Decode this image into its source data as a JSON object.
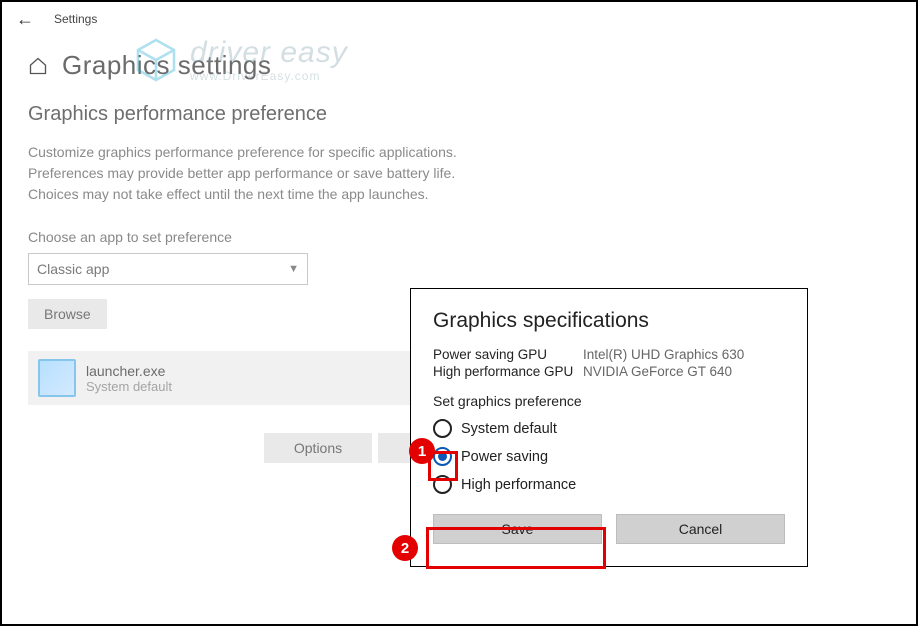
{
  "topbar": {
    "label": "Settings"
  },
  "page": {
    "title": "Graphics settings",
    "subheading": "Graphics performance preference",
    "desc_line1": "Customize graphics performance preference for specific applications.",
    "desc_line2": "Preferences may provide better app performance or save battery life.",
    "desc_line3": "Choices may not take effect until the next time the app launches."
  },
  "chooser": {
    "label": "Choose an app to set preference",
    "selected": "Classic app",
    "browse": "Browse"
  },
  "app": {
    "name": "launcher.exe",
    "subtitle": "System default",
    "options_label": "Options"
  },
  "watermark": {
    "main": "driver easy",
    "sub": "www.DriverEasy.com"
  },
  "dialog": {
    "title": "Graphics specifications",
    "gpus": [
      {
        "label": "Power saving GPU",
        "value": "Intel(R) UHD Graphics 630"
      },
      {
        "label": "High performance GPU",
        "value": "NVIDIA GeForce GT 640"
      }
    ],
    "pref_label": "Set graphics preference",
    "options": {
      "system_default": "System default",
      "power_saving": "Power saving",
      "high_performance": "High performance"
    },
    "save": "Save",
    "cancel": "Cancel"
  },
  "annotations": {
    "step1": "1",
    "step2": "2"
  }
}
